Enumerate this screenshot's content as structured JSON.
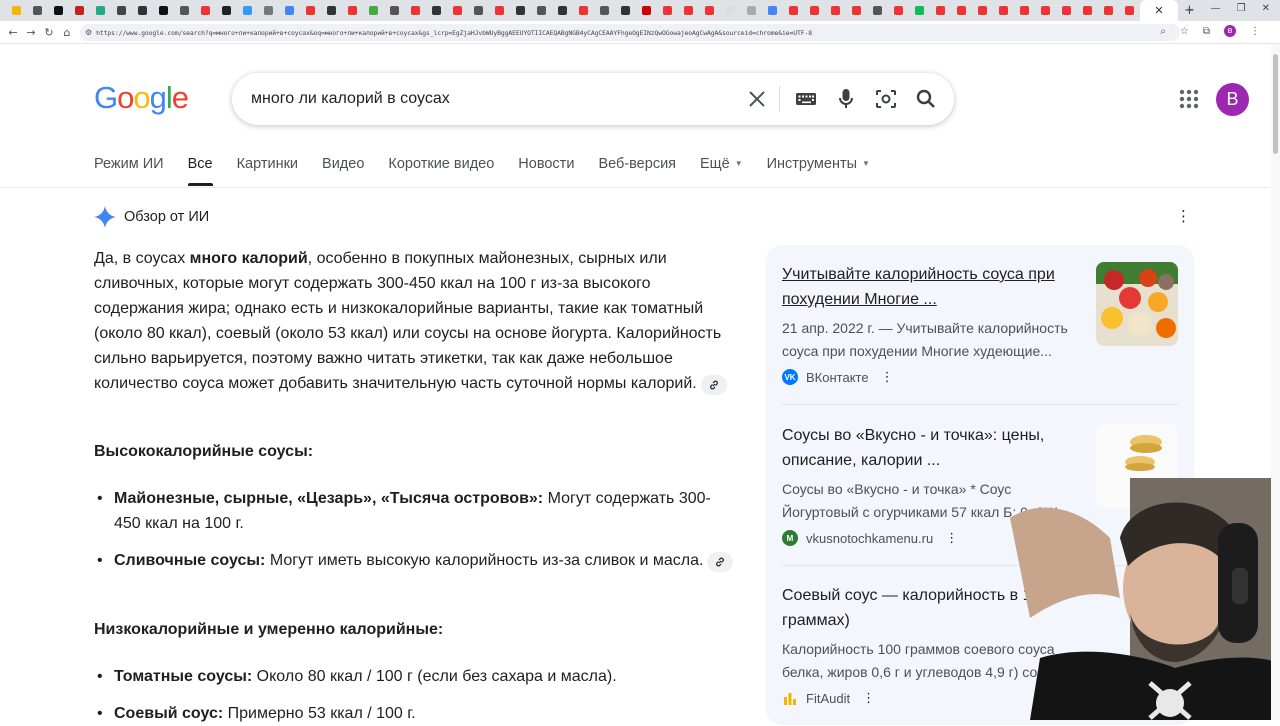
{
  "browser": {
    "url": "https://www.google.com/search?q=много+ли+калорий+в+соусах&oq=много+ли+калорий+в+соусах&gs_lcrp=EgZjaHJvbWUyBggAEEUYOTIICAEQABgNGB4yCAgCEAAYFhgeOgEINzQwOGowajeoAgCwAgA&sourceid=chrome&ie=UTF-8",
    "tab_favicon_colors": [
      "#f4b400",
      "#555",
      "#111",
      "#c5221f",
      "#2a8",
      "#444",
      "#333",
      "#111",
      "#555",
      "#e33",
      "#222",
      "#39f",
      "#777",
      "#4285f4",
      "#e33",
      "#333",
      "#e33",
      "#4a4",
      "#555",
      "#e33",
      "#333",
      "#e33",
      "#555",
      "#e33",
      "#333",
      "#555",
      "#333",
      "#e33",
      "#555",
      "#333",
      "#c00",
      "#e33",
      "#e33",
      "#e33",
      "#ddd",
      "#aaa",
      "#4285f4",
      "#e33",
      "#e33",
      "#e33",
      "#e33",
      "#555",
      "#e33",
      "#1b5",
      "#e33",
      "#e33",
      "#e33",
      "#e33",
      "#e33",
      "#e33",
      "#e33",
      "#e33",
      "#e33",
      "#e33"
    ]
  },
  "header": {
    "logo": "Google",
    "query": "много ли калорий в соусах",
    "avatar_letter": "B"
  },
  "filters": [
    {
      "label": "Режим ИИ",
      "active": false,
      "dropdown": false
    },
    {
      "label": "Все",
      "active": true,
      "dropdown": false
    },
    {
      "label": "Картинки",
      "active": false,
      "dropdown": false
    },
    {
      "label": "Видео",
      "active": false,
      "dropdown": false
    },
    {
      "label": "Короткие видео",
      "active": false,
      "dropdown": false
    },
    {
      "label": "Новости",
      "active": false,
      "dropdown": false
    },
    {
      "label": "Веб-версия",
      "active": false,
      "dropdown": false
    },
    {
      "label": "Ещё",
      "active": false,
      "dropdown": true
    },
    {
      "label": "Инструменты",
      "active": false,
      "dropdown": true
    }
  ],
  "ai_overview": {
    "title": "Обзор от ИИ",
    "intro_before_bold": "Да, в соусах ",
    "intro_bold": "много калорий",
    "intro_after": ", особенно в покупных майонезных, сырных или сливочных, которые могут содержать 300-450 ккал на 100 г из-за высокого содержания жира; однако есть и низкокалорийные варианты, такие как томатный (около 80 ккал), соевый (около 53 ккал) или соусы на основе йогурта. Калорийность сильно варьируется, поэтому важно читать этикетки, так как даже небольшое количество соуса может добавить значительную часть суточной нормы калорий.",
    "section1": "Высококалорийные соусы:",
    "b1_bold": "Майонезные, сырные, «Цезарь», «Тысяча островов»:",
    "b1_text": " Могут содержать 300-450 ккал на 100 г.",
    "b2_bold": "Сливочные соусы:",
    "b2_text": " Могут иметь высокую калорийность из-за сливок и масла.",
    "section2": "Низкокалорийные и умеренно калорийные:",
    "b3_bold": "Томатные соусы:",
    "b3_text": " Около 80 ккал / 100 г (если без сахара и масла).",
    "b4_bold": "Соевый соус:",
    "b4_text": " Примерно 53 ккал / 100 г."
  },
  "sources": [
    {
      "title": "Учитывайте калорийность соуса при похудении Многие ...",
      "snippet": "21 апр. 2022 г. — Учитывайте калорийность соуса при похудении Многие худеющие...",
      "site": "ВКонтакте",
      "icon_letter": "VK",
      "icon_color": "#0077ff"
    },
    {
      "title": "Соусы во «Вкусно - и точка»: цены, описание, калории ...",
      "snippet": "Соусы во «Вкусно - и точка» * Соус Йогуртовый с огурчиками 57 ккал Б: 0г / Ж: ...",
      "site": "vkusnotochkamenu.ru",
      "icon_letter": "M",
      "icon_color": "#2e7d32"
    },
    {
      "title": "Соевый соус — калорийность в 100 граммах)",
      "snippet": "Калорийность 100 граммов соевого соуса белка, жиров 0,6 г и углеводов 4,9 г) сос",
      "site": "FitAudit",
      "icon_letter": "",
      "icon_color": "#f4b400"
    }
  ]
}
